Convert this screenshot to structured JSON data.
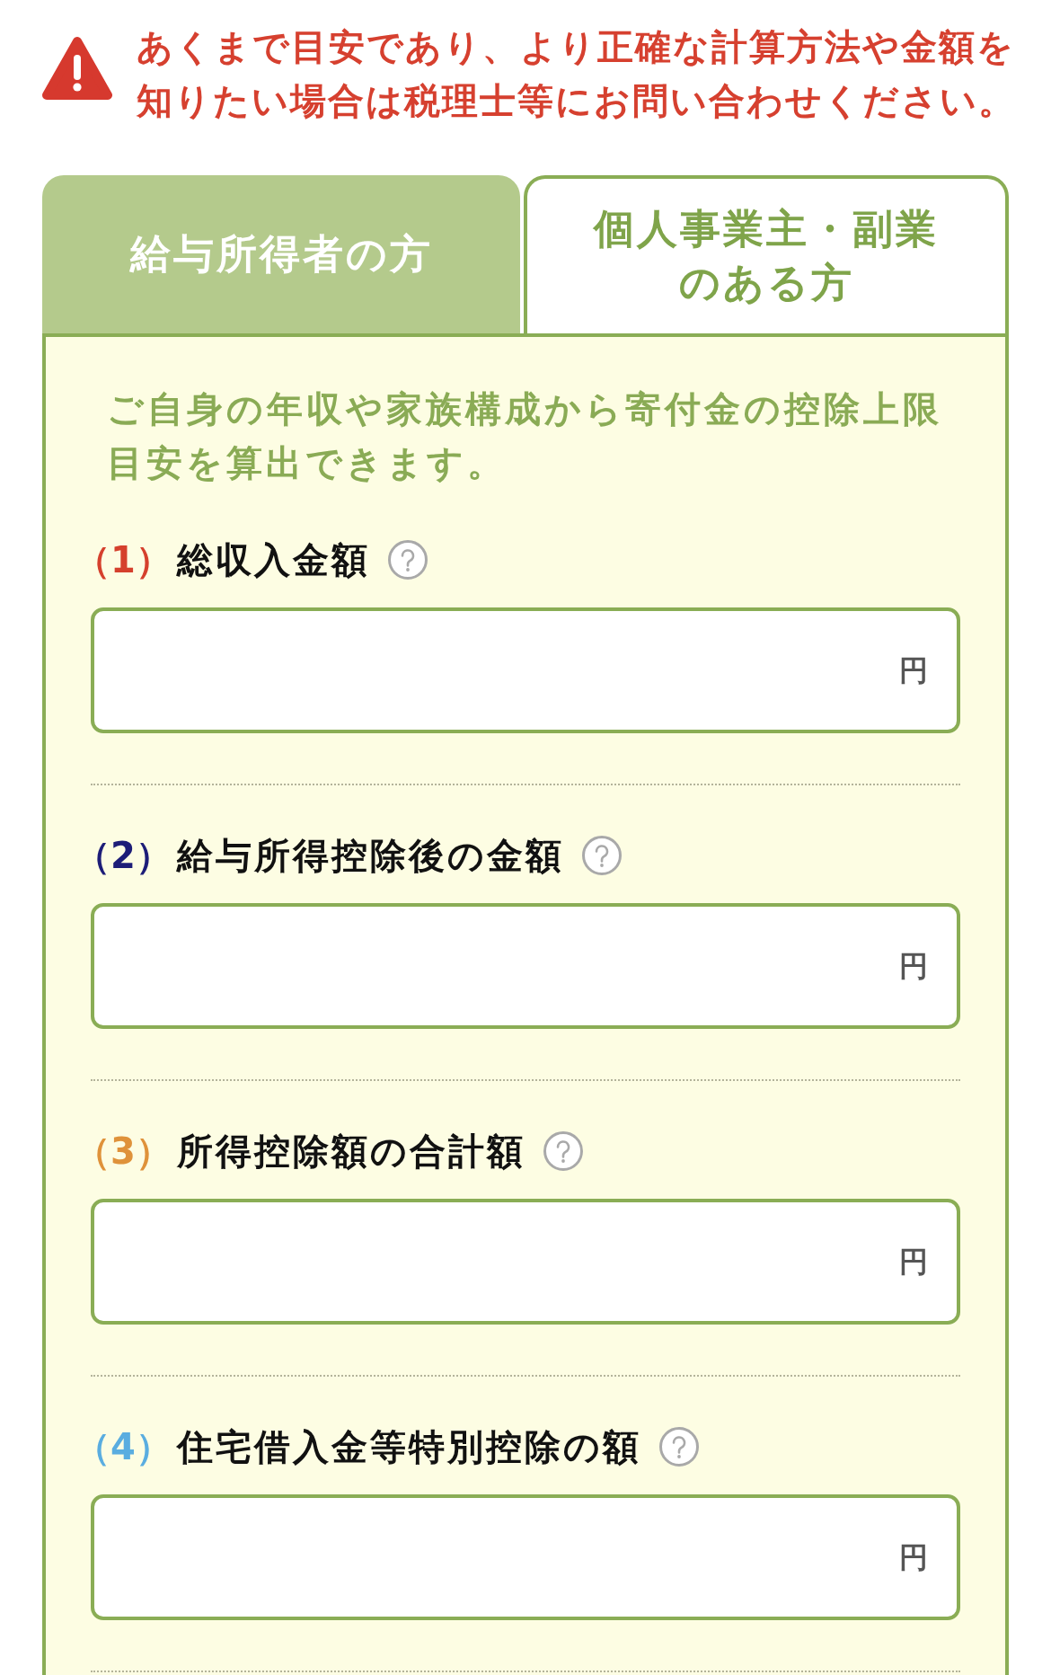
{
  "warning": {
    "text": "あくまで目安であり、より正確な計算方法や金額を知りたい場合は税理士等にお問い合わせください。"
  },
  "tabs": [
    {
      "label": "給与所得者の方",
      "selected": true
    },
    {
      "label": "個人事業主・副業のある方",
      "selected": false
    }
  ],
  "panel": {
    "intro": "ご自身の年収や家族構成から寄付金の控除上限目安を算出できます。",
    "fields": [
      {
        "number": "（1）",
        "label": "総収入金額",
        "color": "#d5402d",
        "unit": "円"
      },
      {
        "number": "（2）",
        "label": "給与所得控除後の金額",
        "color": "#1d1d78",
        "unit": "円"
      },
      {
        "number": "（3）",
        "label": "所得控除額の合計額",
        "color": "#df923a",
        "unit": "円"
      },
      {
        "number": "（4）",
        "label": "住宅借入金等特別控除の額",
        "color": "#5aade0",
        "unit": "円"
      }
    ]
  }
}
